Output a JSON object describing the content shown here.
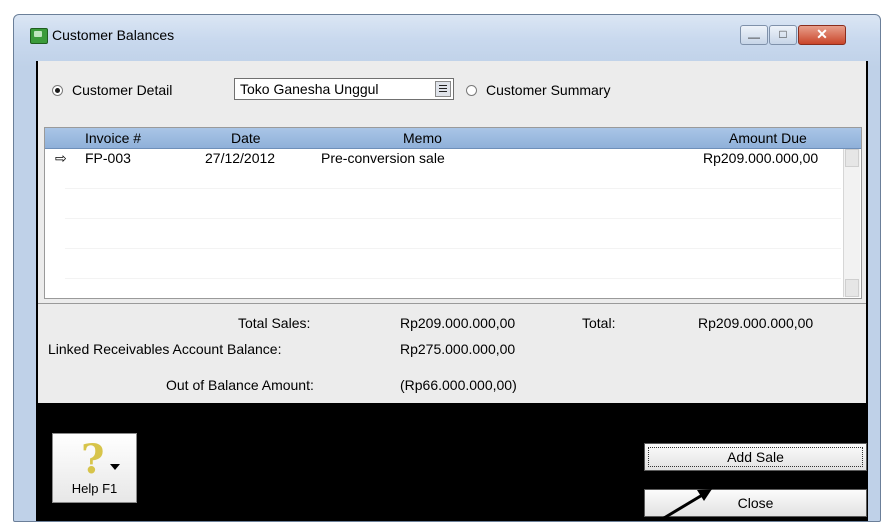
{
  "window": {
    "title": "Customer Balances",
    "controls": {
      "minimize": "—",
      "maximize": "□",
      "close": "✕"
    }
  },
  "filter": {
    "customer_detail_label": "Customer Detail",
    "customer_detail_selected": true,
    "customer_value": "Toko Ganesha Unggul",
    "customer_summary_label": "Customer Summary",
    "customer_summary_selected": false
  },
  "grid": {
    "columns": [
      "Invoice #",
      "Date",
      "Memo",
      "Amount Due"
    ],
    "rows": [
      {
        "invoice": "FP-003",
        "date": "27/12/2012",
        "memo": "Pre-conversion sale",
        "amount_due": "Rp209.000.000,00"
      }
    ]
  },
  "totals": {
    "total_sales_label": "Total Sales:",
    "total_sales_value": "Rp209.000.000,00",
    "total_label": "Total:",
    "total_value": "Rp209.000.000,00",
    "linked_label": "Linked Receivables Account Balance:",
    "linked_value": "Rp275.000.000,00",
    "out_of_balance_label": "Out of Balance Amount:",
    "out_of_balance_value": "(Rp66.000.000,00)"
  },
  "buttons": {
    "help": "Help F1",
    "add_sale": "Add Sale",
    "close": "Close"
  },
  "icons": [
    "app-icon",
    "help-question-icon",
    "row-pointer-icon",
    "dropdown-icon"
  ],
  "colors": {
    "header": "#9dbbe1",
    "window_frame": "#bfd1e8",
    "close_button": "#c9452a"
  }
}
